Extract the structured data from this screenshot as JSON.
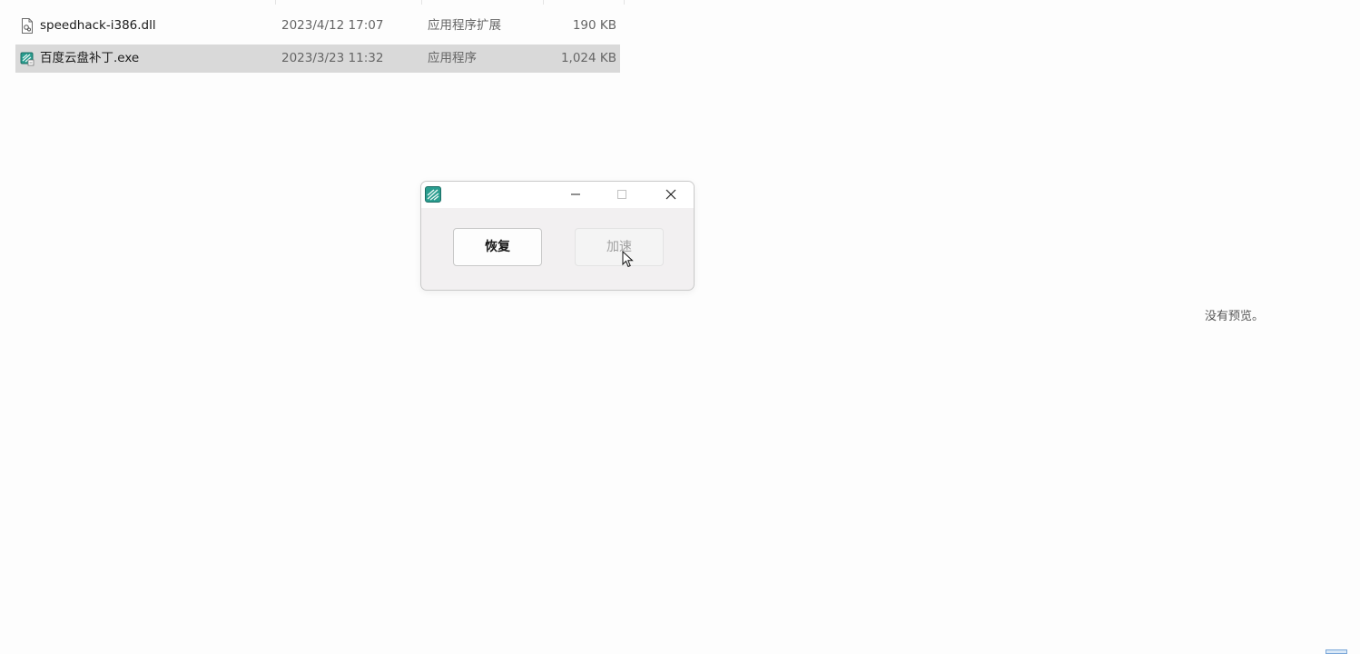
{
  "files": [
    {
      "name": "speedhack-i386.dll",
      "date": "2023/4/12 17:07",
      "type": "应用程序扩展",
      "size": "190 KB",
      "icon": "dll-file-icon",
      "selected": false
    },
    {
      "name": "百度云盘补丁.exe",
      "date": "2023/3/23 11:32",
      "type": "应用程序",
      "size": "1,024 KB",
      "icon": "exe-app-icon",
      "selected": true
    }
  ],
  "dialog": {
    "title": "",
    "app_icon": "app-icon",
    "restore_button": "恢复",
    "speed_button": "加速",
    "speed_button_state": "disabled-hover"
  },
  "preview_pane": {
    "message": "没有预览。"
  },
  "colors": {
    "selection": "#d9d9d9",
    "dialog_bg": "#f2f0f1",
    "accent": "#2a9d8f"
  }
}
